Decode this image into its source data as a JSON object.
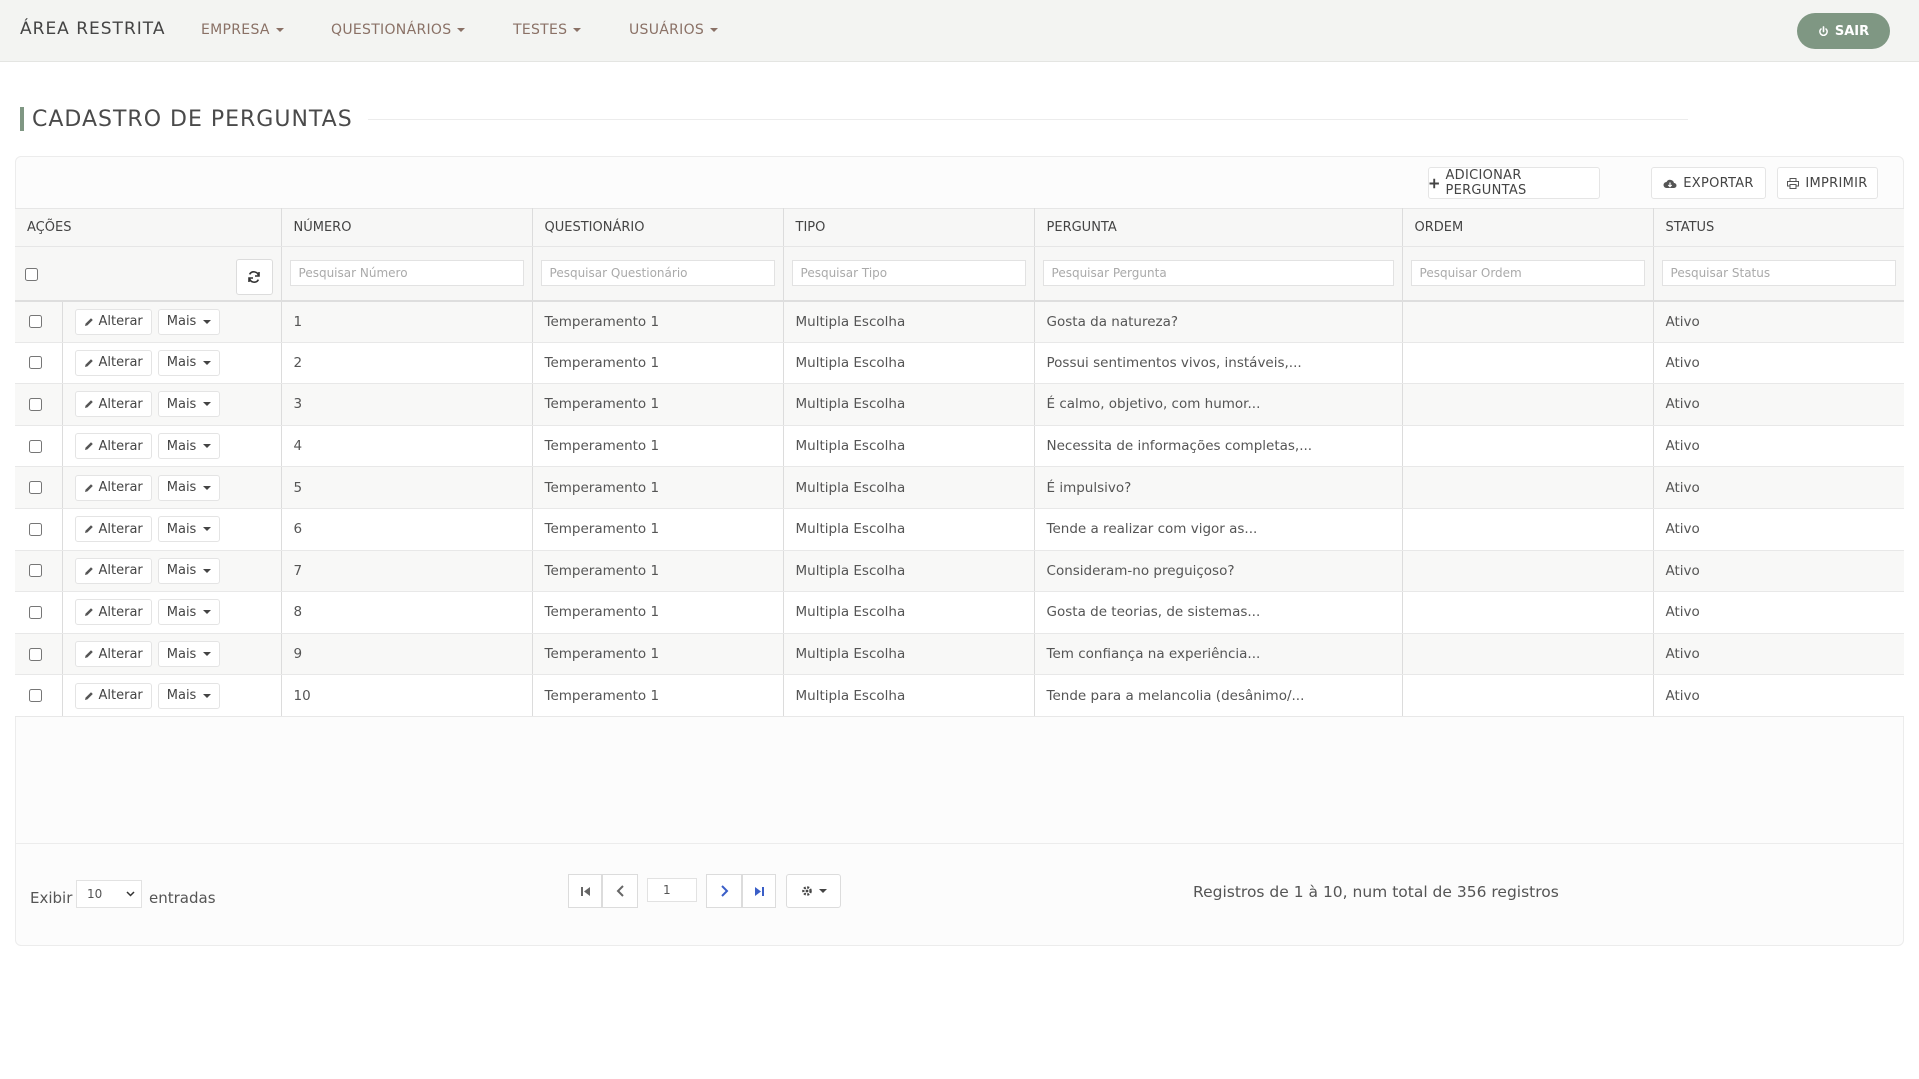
{
  "navbar": {
    "brand": "ÁREA RESTRITA",
    "menu": [
      "EMPRESA",
      "QUESTIONÁRIOS",
      "TESTES",
      "USUÁRIOS"
    ],
    "logout": "SAIR"
  },
  "page": {
    "title": "CADASTRO DE PERGUNTAS"
  },
  "toolbar": {
    "add": "ADICIONAR PERGUNTAS",
    "export": "EXPORTAR",
    "print": "IMPRIMIR"
  },
  "table": {
    "headers": [
      "AÇÕES",
      "NÚMERO",
      "QUESTIONÁRIO",
      "TIPO",
      "PERGUNTA",
      "ORDEM",
      "STATUS"
    ],
    "filters": [
      "Pesquisar Número",
      "Pesquisar Questionário",
      "Pesquisar Tipo",
      "Pesquisar Pergunta",
      "Pesquisar Ordem",
      "Pesquisar Status"
    ],
    "edit_label": "Alterar",
    "more_label": "Mais",
    "rows": [
      {
        "numero": "1",
        "questionario": "Temperamento 1",
        "tipo": "Multipla Escolha",
        "pergunta": "Gosta da natureza?",
        "ordem": "",
        "status": "Ativo"
      },
      {
        "numero": "2",
        "questionario": "Temperamento 1",
        "tipo": "Multipla Escolha",
        "pergunta": "Possui sentimentos vivos, instáveis,...",
        "ordem": "",
        "status": "Ativo"
      },
      {
        "numero": "3",
        "questionario": "Temperamento 1",
        "tipo": "Multipla Escolha",
        "pergunta": "É calmo, objetivo, com humor...",
        "ordem": "",
        "status": "Ativo"
      },
      {
        "numero": "4",
        "questionario": "Temperamento 1",
        "tipo": "Multipla Escolha",
        "pergunta": "Necessita de informações completas,...",
        "ordem": "",
        "status": "Ativo"
      },
      {
        "numero": "5",
        "questionario": "Temperamento 1",
        "tipo": "Multipla Escolha",
        "pergunta": "É impulsivo?",
        "ordem": "",
        "status": "Ativo"
      },
      {
        "numero": "6",
        "questionario": "Temperamento 1",
        "tipo": "Multipla Escolha",
        "pergunta": "Tende a realizar com vigor as...",
        "ordem": "",
        "status": "Ativo"
      },
      {
        "numero": "7",
        "questionario": "Temperamento 1",
        "tipo": "Multipla Escolha",
        "pergunta": "Consideram-no preguiçoso?",
        "ordem": "",
        "status": "Ativo"
      },
      {
        "numero": "8",
        "questionario": "Temperamento 1",
        "tipo": "Multipla Escolha",
        "pergunta": "Gosta de teorias, de sistemas...",
        "ordem": "",
        "status": "Ativo"
      },
      {
        "numero": "9",
        "questionario": "Temperamento 1",
        "tipo": "Multipla Escolha",
        "pergunta": "Tem confiança na experiência...",
        "ordem": "",
        "status": "Ativo"
      },
      {
        "numero": "10",
        "questionario": "Temperamento 1",
        "tipo": "Multipla Escolha",
        "pergunta": "Tende para a melancolia (desânimo/...",
        "ordem": "",
        "status": "Ativo"
      }
    ]
  },
  "footer": {
    "show_label": "Exibir",
    "page_size": "10",
    "entries_label": "entradas",
    "current_page": "1",
    "info": "Registros de 1 à 10, num total de 356 registros"
  },
  "colors": {
    "accent": "#7f9783",
    "nav_text": "#8a7166",
    "navbar_bg": "#f3f4f2"
  },
  "icons": [
    "power-icon",
    "plus-icon",
    "cloud-download-icon",
    "print-icon",
    "pencil-icon",
    "refresh-icon",
    "first-page-icon",
    "prev-page-icon",
    "next-page-icon",
    "last-page-icon",
    "gear-icon"
  ]
}
